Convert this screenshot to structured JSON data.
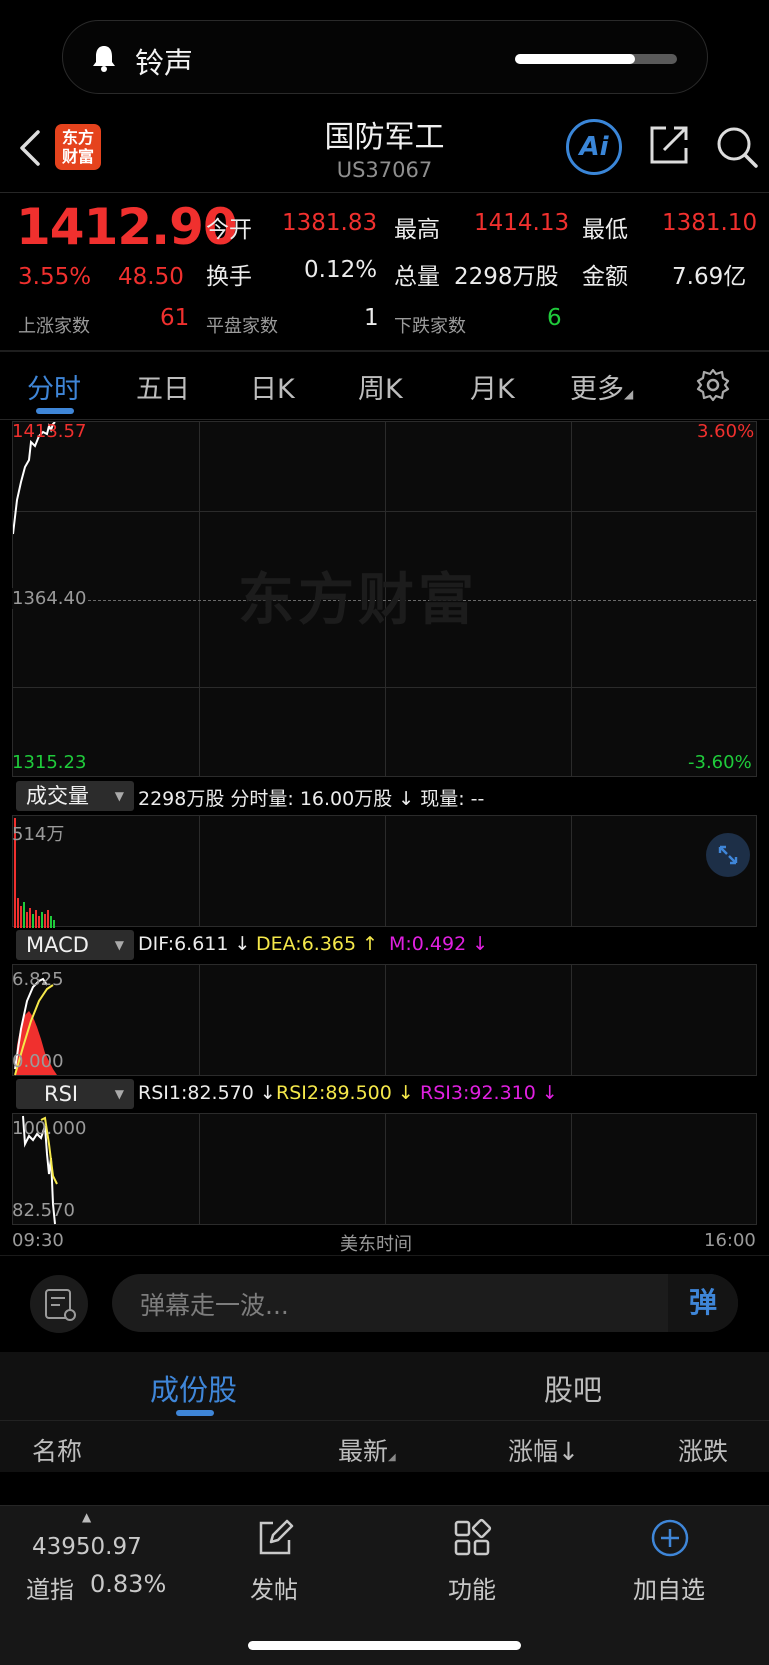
{
  "notification": {
    "label": "铃声",
    "volume_level": 0.74,
    "icon": "bell-icon"
  },
  "header": {
    "logo_text_line1": "东方",
    "logo_text_line2": "财富",
    "title": "国防军工",
    "code": "US37067",
    "ai_label": "Ai",
    "icons": [
      "back-arrow-icon",
      "share-icon",
      "search-icon"
    ]
  },
  "quote": {
    "price": "1412.90",
    "change_pct": "3.55%",
    "change": "48.50",
    "open_label": "今开",
    "open_value": "1381.83",
    "high_label": "最高",
    "high_value": "1414.13",
    "low_label": "最低",
    "low_value": "1381.10",
    "turnover_label": "换手",
    "turnover_value": "0.12%",
    "volume_label": "总量",
    "volume_value": "2298万股",
    "amount_label": "金额",
    "amount_value": "7.69亿",
    "up_label": "上涨家数",
    "up_value": "61",
    "flat_label": "平盘家数",
    "flat_value": "1",
    "down_label": "下跌家数",
    "down_value": "6"
  },
  "tabs": [
    "分时",
    "五日",
    "日K",
    "周K",
    "月K",
    "更多"
  ],
  "active_tab": "分时",
  "chart": {
    "price_top": "1413.57",
    "price_mid": "1364.40",
    "price_bottom": "1315.23",
    "pct_top": "3.60%",
    "pct_bottom": "-3.60%",
    "watermark": "东方财富",
    "volume_select": "成交量",
    "volume_summary": "2298万股 分时量: 16.00万股 ↓ 现量: --",
    "volume_max": "514万",
    "macd_select": "MACD",
    "macd_dif": "DIF:6.611 ↓",
    "macd_dea": "DEA:6.365 ↑",
    "macd_m": "M:0.492 ↓",
    "macd_top": "6.825",
    "macd_bottom": "0.000",
    "rsi_select": "RSI",
    "rsi1": "RSI1:82.570 ↓",
    "rsi2": "RSI2:89.500 ↓",
    "rsi3": "RSI3:92.310 ↓",
    "rsi_top": "100.000",
    "rsi_bottom": "82.570",
    "time_start": "09:30",
    "time_label": "美东时间",
    "time_end": "16:00"
  },
  "comment": {
    "placeholder": "弹幕走一波...",
    "danmu_label": "弹"
  },
  "sub_tabs": [
    "成份股",
    "股吧"
  ],
  "list_headers": {
    "name": "名称",
    "latest": "最新",
    "change_pct": "涨幅↓",
    "change": "涨跌"
  },
  "bottom_nav": {
    "index_value": "43950.97",
    "index_name": "道指",
    "index_pct": "0.83%",
    "post": "发帖",
    "functions": "功能",
    "add_watch": "加自选"
  },
  "colors": {
    "up": "#f0302e",
    "down": "#1fcb3b",
    "accent": "#3f86d8",
    "dea": "#f5e84a",
    "m": "#e020e0"
  }
}
